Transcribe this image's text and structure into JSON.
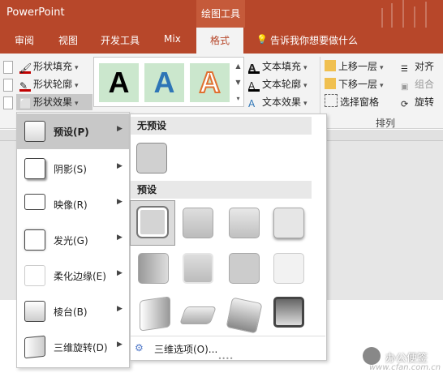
{
  "app": {
    "title": "PowerPoint",
    "context_group": "绘图工具"
  },
  "tabs": [
    "审阅",
    "视图",
    "开发工具",
    "Mix"
  ],
  "active_tab": "格式",
  "tell_me": "告诉我你想要做什么",
  "ribbon": {
    "shape_group": {
      "fill": "形状填充",
      "outline": "形状轮廓",
      "effects": "形状效果"
    },
    "style_gallery": [
      "A",
      "A",
      "A"
    ],
    "text_group": {
      "fill": "文本填充",
      "outline": "文本轮廓",
      "effects": "文本效果"
    },
    "arrange_group": {
      "bring_forward": "上移一层",
      "send_backward": "下移一层",
      "selection_pane": "选择窗格",
      "align": "对齐",
      "group": "组合",
      "rotate": "旋转",
      "label": "排列"
    }
  },
  "effects_menu": [
    {
      "label": "预设(P)"
    },
    {
      "label": "阴影(S)"
    },
    {
      "label": "映像(R)"
    },
    {
      "label": "发光(G)"
    },
    {
      "label": "柔化边缘(E)"
    },
    {
      "label": "棱台(B)"
    },
    {
      "label": "三维旋转(D)"
    }
  ],
  "preset_submenu": {
    "no_preset_header": "无预设",
    "preset_header": "预设",
    "three_d_options": "三维选项(O)..."
  },
  "watermark": {
    "name": "办公便签",
    "site": "www.cfan.com.cn"
  },
  "colors": {
    "brand": "#b7472a",
    "gallery_bg": "#cbe7cd",
    "accent_blue": "#2e75b6"
  }
}
